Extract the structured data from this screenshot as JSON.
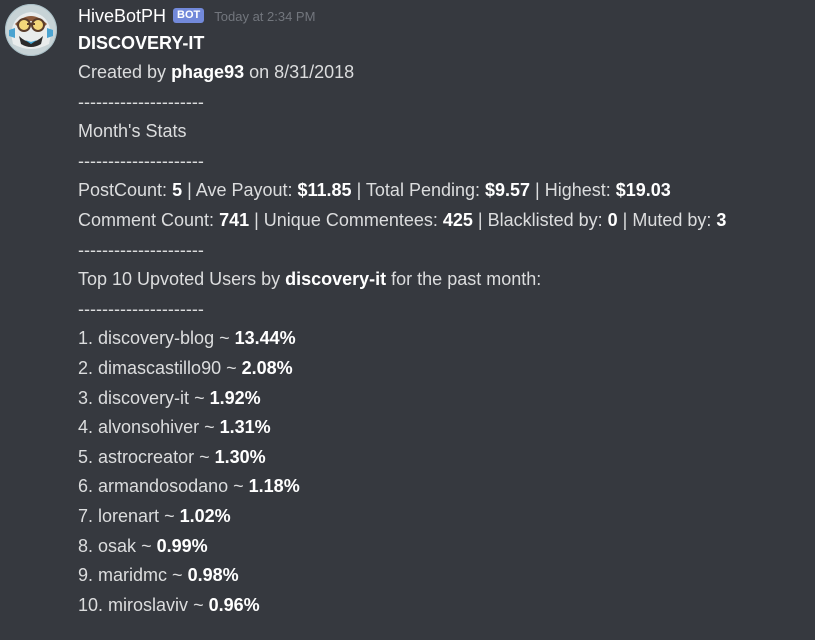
{
  "author": {
    "name": "HiveBotPH",
    "tag": "BOT",
    "timestamp": "Today at 2:34 PM"
  },
  "message": {
    "title": "DISCOVERY-IT",
    "created": {
      "prefix": "Created by ",
      "creator": "phage93",
      "suffix": " on 8/31/2018"
    },
    "separator": "---------------------",
    "stats_heading": "Month's Stats",
    "stats_row1": [
      {
        "label": "PostCount: ",
        "value": "5"
      },
      {
        "label": " | Ave Payout: ",
        "value": "$11.85"
      },
      {
        "label": " | Total Pending: ",
        "value": "$9.57"
      },
      {
        "label": " | Highest: ",
        "value": "$19.03"
      }
    ],
    "stats_row2": [
      {
        "label": "Comment Count: ",
        "value": "741"
      },
      {
        "label": " | Unique Commentees: ",
        "value": "425"
      },
      {
        "label": " | Blacklisted by: ",
        "value": "0"
      },
      {
        "label": " | Muted by: ",
        "value": "3"
      }
    ],
    "top_heading": {
      "prefix": "Top 10 Upvoted Users by ",
      "account": "discovery-it",
      "suffix": " for the past month:"
    },
    "top_users": [
      {
        "rank": "1.",
        "name": "discovery-blog",
        "percent": "13.44%"
      },
      {
        "rank": "2.",
        "name": "dimascastillo90",
        "percent": "2.08%"
      },
      {
        "rank": "3.",
        "name": "discovery-it",
        "percent": "1.92%"
      },
      {
        "rank": "4.",
        "name": "alvonsohiver",
        "percent": "1.31%"
      },
      {
        "rank": "5.",
        "name": "astrocreator",
        "percent": "1.30%"
      },
      {
        "rank": "6.",
        "name": "armandosodano",
        "percent": "1.18%"
      },
      {
        "rank": "7.",
        "name": "lorenart",
        "percent": "1.02%"
      },
      {
        "rank": "8.",
        "name": "osak",
        "percent": "0.99%"
      },
      {
        "rank": "9.",
        "name": "maridmc",
        "percent": "0.98%"
      },
      {
        "rank": "10.",
        "name": "miroslaviv",
        "percent": "0.96%"
      }
    ]
  },
  "colors": {
    "background": "#36393f",
    "text": "#dcddde",
    "bold": "#ffffff",
    "bot_tag": "#7289da",
    "timestamp": "#72767d"
  }
}
